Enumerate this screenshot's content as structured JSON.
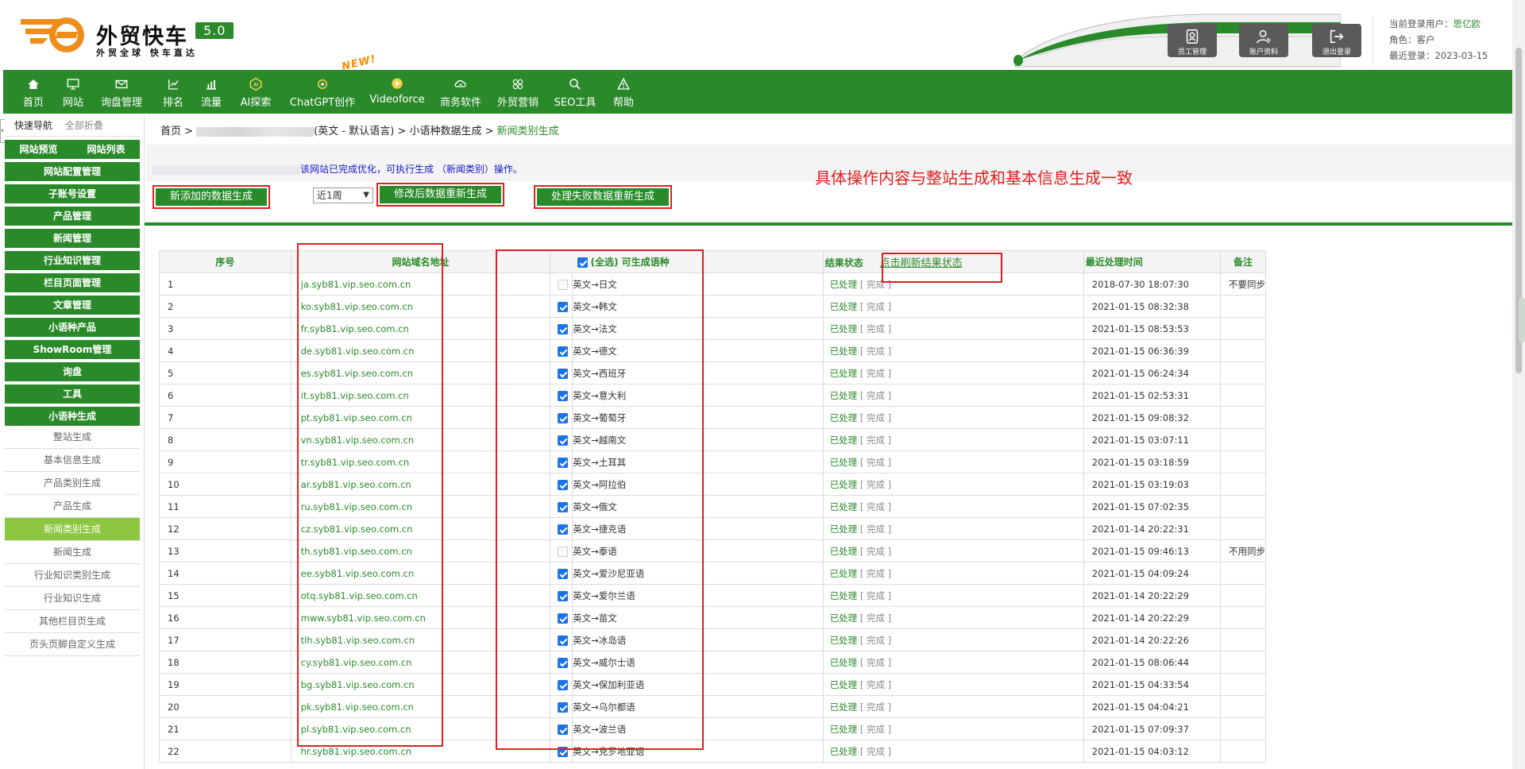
{
  "header": {
    "brand": "外贸快车",
    "version": "5.0",
    "slogan": "外贸全球  快车直达",
    "buttons": [
      {
        "label": "员工管理",
        "icon": "staff-icon"
      },
      {
        "label": "账户资料",
        "icon": "user-icon"
      },
      {
        "label": "退出登录",
        "icon": "logout-icon"
      }
    ],
    "user": {
      "login_label": "当前登录用户：",
      "login_name": "思亿欧",
      "role_label": "角色：",
      "role": "客户",
      "last_label": "最近登录：",
      "last_date": "2023-03-15"
    }
  },
  "nav": {
    "new_badge": "NEW!",
    "items": [
      {
        "label": "首页",
        "icon": "home-icon"
      },
      {
        "label": "网站",
        "icon": "monitor-icon"
      },
      {
        "label": "询盘管理",
        "icon": "mail-icon"
      },
      {
        "label": "排名",
        "icon": "rank-icon"
      },
      {
        "label": "流量",
        "icon": "chart-icon"
      },
      {
        "label": "AI探索",
        "icon": "ai-icon"
      },
      {
        "label": "ChatGPT创作",
        "icon": "chatgpt-icon"
      },
      {
        "label": "Videoforce",
        "icon": "video-icon"
      },
      {
        "label": "商务软件",
        "icon": "software-icon"
      },
      {
        "label": "外贸营销",
        "icon": "marketing-icon"
      },
      {
        "label": "SEO工具",
        "icon": "search-icon"
      },
      {
        "label": "帮助",
        "icon": "help-icon"
      }
    ]
  },
  "sidebar": {
    "quick_nav": "快速导航",
    "collapse_all": "全部折叠",
    "tabs": [
      "网站预览",
      "网站列表"
    ],
    "groups": [
      "网站配置管理",
      "子账号设置",
      "产品管理",
      "新闻管理",
      "行业知识管理",
      "栏目页面管理",
      "文章管理",
      "小语种产品",
      "ShowRoom管理",
      "询盘",
      "工具",
      "小语种生成"
    ],
    "subitems": [
      "整站生成",
      "基本信息生成",
      "产品类别生成",
      "产品生成",
      "新闻类别生成",
      "新闻生成",
      "行业知识类别生成",
      "行业知识生成",
      "其他栏目页生成",
      "页头页脚自定义生成"
    ],
    "active_subitem": "新闻类别生成"
  },
  "breadcrumb": {
    "home": "首页 >",
    "site_suffix": "(英文 - 默认语言) >",
    "parent": "小语种数据生成 >",
    "current": "新闻类别生成"
  },
  "notice": "该网站已完成优化，可执行生成 （新闻类别）操作。",
  "annotation": "具体操作内容与整站生成和基本信息生成一致",
  "actions": {
    "generate_new": "新添加的数据生成",
    "period": "近1周",
    "regenerate_modified": "修改后数据重新生成",
    "regenerate_failed": "处理失败数据重新生成"
  },
  "table": {
    "headers": {
      "index": "序号",
      "domain": "网站域名地址",
      "select_all": "(全选)",
      "languages": "可生成语种",
      "result": "结果状态",
      "refresh": "点击刷新结果状态",
      "last_time": "最近处理时间",
      "remark": "备注"
    },
    "status_done": "已处理",
    "status_complete": "[ 完成 ]",
    "rows": [
      {
        "no": "1",
        "domain": "ja.syb81.vip.seo.com.cn",
        "lang": "英文→日文",
        "checked": false,
        "time": "2018-07-30 18:07:30",
        "remark": "不要同步"
      },
      {
        "no": "2",
        "domain": "ko.syb81.vip.seo.com.cn",
        "lang": "英文→韩文",
        "checked": true,
        "time": "2021-01-15 08:32:38",
        "remark": ""
      },
      {
        "no": "3",
        "domain": "fr.syb81.vip.seo.com.cn",
        "lang": "英文→法文",
        "checked": true,
        "time": "2021-01-15 08:53:53",
        "remark": ""
      },
      {
        "no": "4",
        "domain": "de.syb81.vip.seo.com.cn",
        "lang": "英文→德文",
        "checked": true,
        "time": "2021-01-15 06:36:39",
        "remark": ""
      },
      {
        "no": "5",
        "domain": "es.syb81.vip.seo.com.cn",
        "lang": "英文→西班牙",
        "checked": true,
        "time": "2021-01-15 06:24:34",
        "remark": ""
      },
      {
        "no": "6",
        "domain": "it.syb81.vip.seo.com.cn",
        "lang": "英文→意大利",
        "checked": true,
        "time": "2021-01-15 02:53:31",
        "remark": ""
      },
      {
        "no": "7",
        "domain": "pt.syb81.vip.seo.com.cn",
        "lang": "英文→葡萄牙",
        "checked": true,
        "time": "2021-01-15 09:08:32",
        "remark": ""
      },
      {
        "no": "8",
        "domain": "vn.syb81.vip.seo.com.cn",
        "lang": "英文→越南文",
        "checked": true,
        "time": "2021-01-15 03:07:11",
        "remark": ""
      },
      {
        "no": "9",
        "domain": "tr.syb81.vip.seo.com.cn",
        "lang": "英文→土耳其",
        "checked": true,
        "time": "2021-01-15 03:18:59",
        "remark": ""
      },
      {
        "no": "10",
        "domain": "ar.syb81.vip.seo.com.cn",
        "lang": "英文→阿拉伯",
        "checked": true,
        "time": "2021-01-15 03:19:03",
        "remark": ""
      },
      {
        "no": "11",
        "domain": "ru.syb81.vip.seo.com.cn",
        "lang": "英文→俄文",
        "checked": true,
        "time": "2021-01-15 07:02:35",
        "remark": ""
      },
      {
        "no": "12",
        "domain": "cz.syb81.vip.seo.com.cn",
        "lang": "英文→捷克语",
        "checked": true,
        "time": "2021-01-14 20:22:31",
        "remark": ""
      },
      {
        "no": "13",
        "domain": "th.syb81.vip.seo.com.cn",
        "lang": "英文→泰语",
        "checked": false,
        "time": "2021-01-15 09:46:13",
        "remark": "不用同步"
      },
      {
        "no": "14",
        "domain": "ee.syb81.vip.seo.com.cn",
        "lang": "英文→爱沙尼亚语",
        "checked": true,
        "time": "2021-01-15 04:09:24",
        "remark": ""
      },
      {
        "no": "15",
        "domain": "otq.syb81.vip.seo.com.cn",
        "lang": "英文→爱尔兰语",
        "checked": true,
        "time": "2021-01-14 20:22:29",
        "remark": ""
      },
      {
        "no": "16",
        "domain": "mww.syb81.vip.seo.com.cn",
        "lang": "英文→苗文",
        "checked": true,
        "time": "2021-01-14 20:22:29",
        "remark": ""
      },
      {
        "no": "17",
        "domain": "tlh.syb81.vip.seo.com.cn",
        "lang": "英文→冰岛语",
        "checked": true,
        "time": "2021-01-14 20:22:26",
        "remark": ""
      },
      {
        "no": "18",
        "domain": "cy.syb81.vip.seo.com.cn",
        "lang": "英文→威尔士语",
        "checked": true,
        "time": "2021-01-15 08:06:44",
        "remark": ""
      },
      {
        "no": "19",
        "domain": "bg.syb81.vip.seo.com.cn",
        "lang": "英文→保加利亚语",
        "checked": true,
        "time": "2021-01-15 04:33:54",
        "remark": ""
      },
      {
        "no": "20",
        "domain": "pk.syb81.vip.seo.com.cn",
        "lang": "英文→乌尔都语",
        "checked": true,
        "time": "2021-01-15 04:04:21",
        "remark": ""
      },
      {
        "no": "21",
        "domain": "pl.syb81.vip.seo.com.cn",
        "lang": "英文→波兰语",
        "checked": true,
        "time": "2021-01-15 07:09:37",
        "remark": ""
      },
      {
        "no": "22",
        "domain": "hr.syb81.vip.seo.com.cn",
        "lang": "英文→克罗地亚语",
        "checked": true,
        "time": "2021-01-15 04:03:12",
        "remark": ""
      }
    ]
  },
  "colors": {
    "brand_green": "#2a8a2a",
    "active_sub": "#8dc63f",
    "annotation_red": "#e02020",
    "logo_orange": "#f08c1a"
  }
}
